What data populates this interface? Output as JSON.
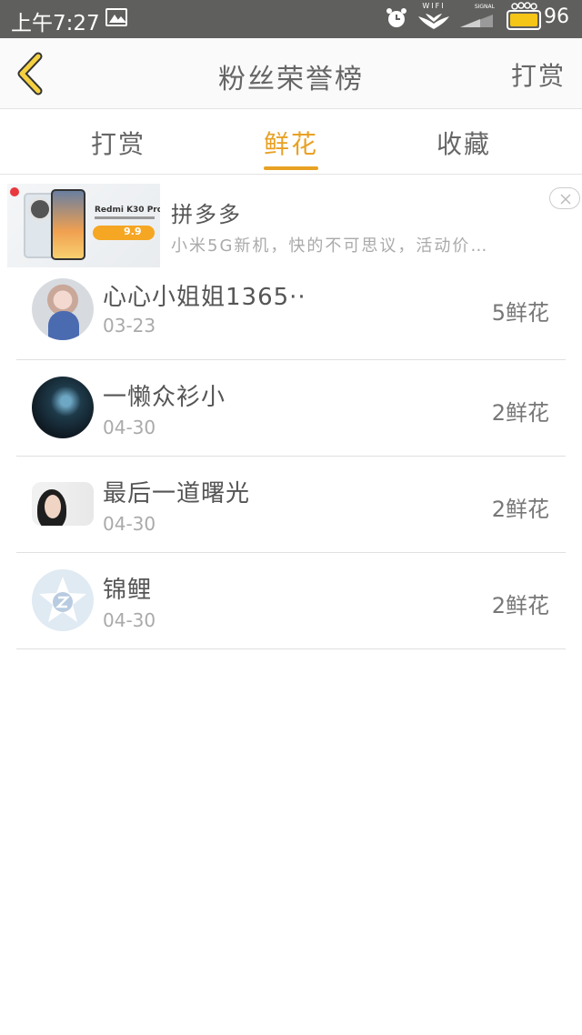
{
  "status_bar": {
    "time": "上午7:27",
    "wifi_label": "WIFI",
    "signal_label": "SIGNAL",
    "battery": "96",
    "battery_color": "#f5c518",
    "icons": [
      "image-icon",
      "alarm-icon",
      "wifi-icon",
      "signal-icon",
      "battery-icon"
    ]
  },
  "header": {
    "title": "粉丝荣誉榜",
    "action": "打赏",
    "accent_color": "#e8a124"
  },
  "tabs": [
    {
      "label": "打赏",
      "active": false
    },
    {
      "label": "鲜花",
      "active": true
    },
    {
      "label": "收藏",
      "active": false
    }
  ],
  "ad": {
    "title": "拼多多",
    "description": "小米5G新机，快的不可思议，活动价…",
    "product": "Redmi K30 Pro",
    "price": "9.9"
  },
  "fans": [
    {
      "name": "心心小姐姐1365··",
      "date": "03-23",
      "amount": "5鲜花"
    },
    {
      "name": "一懒众衫小",
      "date": "04-30",
      "amount": "2鲜花"
    },
    {
      "name": "最后一道曙光",
      "date": "04-30",
      "amount": "2鲜花"
    },
    {
      "name": "锦鲤",
      "date": "04-30",
      "amount": "2鲜花"
    }
  ]
}
